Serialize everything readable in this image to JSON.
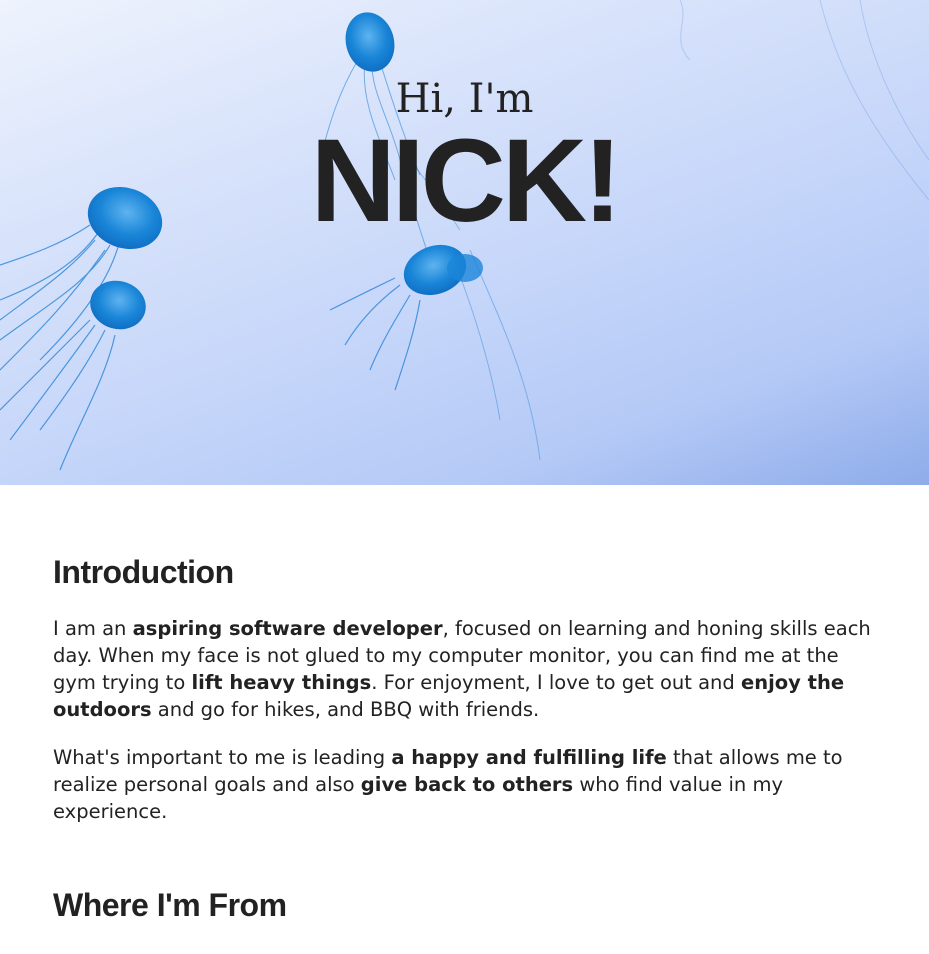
{
  "hero": {
    "greeting": "Hi, I'm",
    "name": "NICK!",
    "background": "jellyfish-photo",
    "accent": "#1f7fe0"
  },
  "intro": {
    "title": "Introduction",
    "p1": {
      "t1": "I am an ",
      "b1": "aspiring software developer",
      "t2": ", focused on learning and honing skills each day. When my face is not glued to my computer monitor, you can find me at the gym trying to ",
      "b2": "lift heavy things",
      "t3": ". For enjoyment, I love to get out and ",
      "b3": "enjoy the outdoors",
      "t4": " and go for hikes, and BBQ with friends."
    },
    "p2": {
      "t1": "What's important to me is leading ",
      "b1": "a happy and fulfilling life",
      "t2": " that allows me to realize personal goals and also ",
      "b2": "give back to others",
      "t3": " who find value in my experience."
    }
  },
  "from": {
    "title": "Where I'm From"
  }
}
